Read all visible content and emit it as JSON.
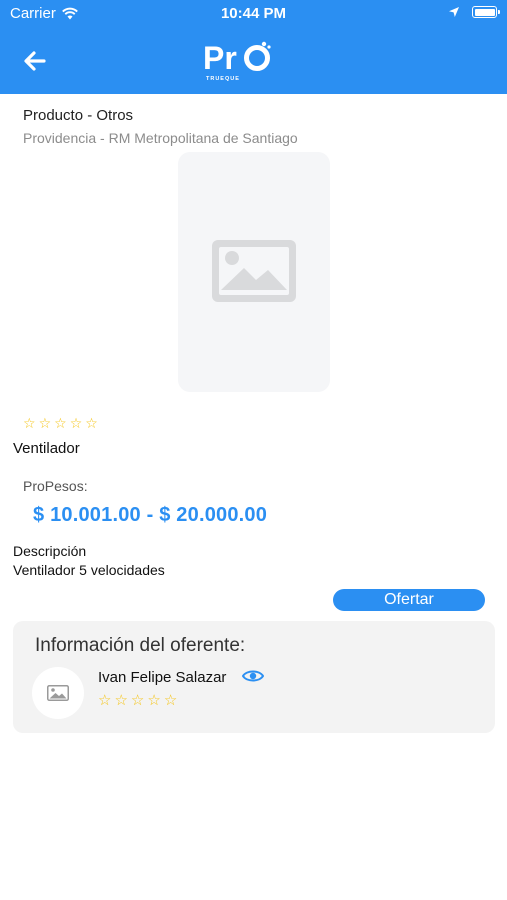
{
  "status_bar": {
    "carrier": "Carrier",
    "time": "10:44 PM"
  },
  "header": {
    "back_icon": "arrow-left-icon",
    "logo_text": "Pro",
    "logo_subtext": "TRUEQUE"
  },
  "product": {
    "category_title": "Producto - Otros",
    "location": "Providencia - RM Metropolitana de Santiago",
    "image_icon": "image-placeholder-icon",
    "rating_stars": 0,
    "rating_max": 5,
    "name": "Ventilador",
    "price_label": "ProPesos:",
    "price_range": "$ 10.001.00 - $ 20.000.00",
    "description_label": "Descripción",
    "description": "Ventilador 5 velocidades"
  },
  "actions": {
    "offer_label": "Ofertar"
  },
  "seller": {
    "heading": "Información del oferente:",
    "name": "Ivan Felipe Salazar",
    "avatar_icon": "image-placeholder-icon",
    "view_icon": "eye-icon",
    "rating_stars": 0,
    "rating_max": 5
  },
  "colors": {
    "brand_blue": "#2b8ff2",
    "star": "#f5c518",
    "card_bg": "#f3f3f3"
  }
}
